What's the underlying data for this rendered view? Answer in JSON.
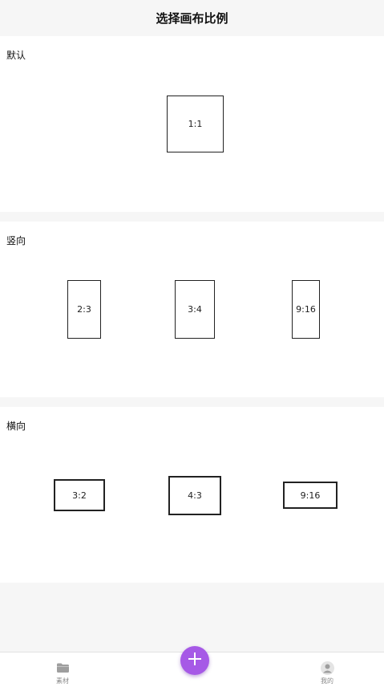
{
  "header": {
    "title": "选择画布比例"
  },
  "sections": {
    "default": {
      "label": "默认",
      "ratios": [
        "1:1"
      ]
    },
    "portrait": {
      "label": "竖向",
      "ratios": [
        "2:3",
        "3:4",
        "9:16"
      ]
    },
    "landscape": {
      "label": "横向",
      "ratios": [
        "3:2",
        "4:3",
        "9:16"
      ]
    }
  },
  "tabbar": {
    "material": {
      "label": "素材",
      "icon": "folder-icon"
    },
    "add": {
      "icon": "plus-icon"
    },
    "mine": {
      "label": "我的",
      "icon": "user-icon"
    }
  },
  "colors": {
    "accent": "#a659e6",
    "background": "#f6f6f6",
    "card": "#ffffff"
  }
}
